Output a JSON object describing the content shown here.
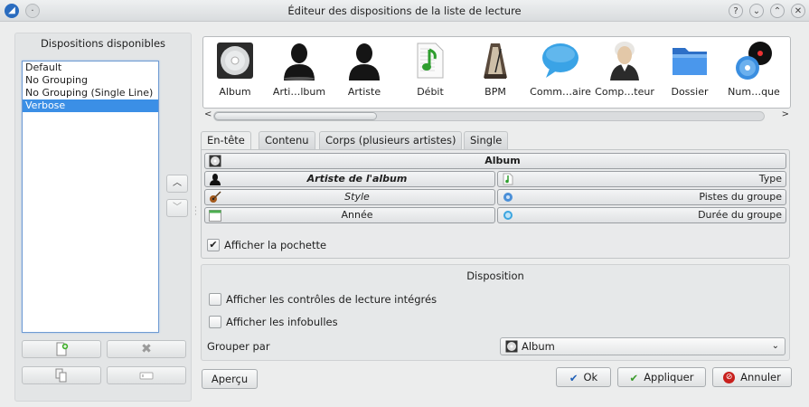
{
  "window": {
    "title": "Éditeur des dispositions de la liste de lecture"
  },
  "left": {
    "title": "Dispositions disponibles",
    "layouts": [
      "Default",
      "No Grouping",
      "No Grouping (Single Line)",
      "Verbose"
    ],
    "selected": "Verbose"
  },
  "tokens": [
    {
      "label": "Album",
      "icon": "cd-disc-icon"
    },
    {
      "label": "Arti…lbum",
      "icon": "album-artist-silhouette-icon"
    },
    {
      "label": "Artiste",
      "icon": "artist-silhouette-icon"
    },
    {
      "label": "Débit",
      "icon": "audio-file-icon"
    },
    {
      "label": "BPM",
      "icon": "metronome-icon"
    },
    {
      "label": "Comm…aire",
      "icon": "speech-bubble-icon"
    },
    {
      "label": "Comp…teur",
      "icon": "composer-portrait-icon"
    },
    {
      "label": "Dossier",
      "icon": "folder-icon"
    },
    {
      "label": "Num…que",
      "icon": "disc-number-icon"
    }
  ],
  "tabs": [
    "En-tête",
    "Contenu",
    "Corps (plusieurs artistes)",
    "Single"
  ],
  "header_rows": {
    "album": "Album",
    "album_artist": "Artiste de l'album",
    "type": "Type",
    "style": "Style",
    "group_tracks": "Pistes du groupe",
    "year": "Année",
    "group_duration": "Durée du groupe"
  },
  "show_cover": {
    "label": "Afficher la pochette",
    "checked": true
  },
  "disposition": {
    "title": "Disposition",
    "inline_controls": {
      "label": "Afficher les contrôles de lecture intégrés",
      "checked": false
    },
    "tooltips": {
      "label": "Afficher les infobulles",
      "checked": false
    },
    "group_by_label": "Grouper par",
    "group_by_value": "Album"
  },
  "buttons": {
    "preview": "Aperçu",
    "ok": "Ok",
    "apply": "Appliquer",
    "cancel": "Annuler"
  },
  "colors": {
    "selection": "#3b8fe6",
    "ok_check": "#1e5fb7",
    "apply_check": "#3a9a2a",
    "cancel_red": "#c8201d"
  }
}
